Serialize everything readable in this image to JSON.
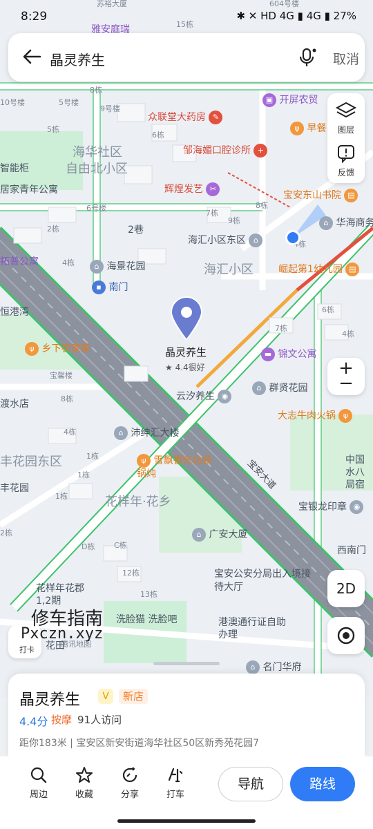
{
  "status_bar": {
    "time": "8:29",
    "right": "✱ ✕ HD 4G ▮ 4G ▮ 27%"
  },
  "search": {
    "query": "晶灵养生",
    "cancel_label": "取消"
  },
  "tools": {
    "layers_label": "图层",
    "feedback_label": "反馈"
  },
  "map": {
    "buildings": [
      "604号楼",
      "苏裕大厦",
      "雅安庭瑞",
      "15栋",
      "8栋",
      "10号楼",
      "5号楼",
      "9号楼",
      "5栋",
      "6栋",
      "6号楼",
      "2栋",
      "2巷",
      "4栋",
      "宝馨楼",
      "8栋",
      "4栋",
      "1栋",
      "1栋",
      "1栋",
      "2栋",
      "D栋",
      "C栋",
      "12栋",
      "13栋",
      "7栋",
      "9栋",
      "8栋",
      "6栋",
      "4栋",
      "7栋",
      "4栋"
    ],
    "districts": [
      "海华社区",
      "自由北小区",
      "海汇小区",
      "花样年·花乡",
      "丰花园东区"
    ],
    "labels": [
      {
        "text": "众联堂大药房",
        "cls": "poi-red"
      },
      {
        "text": "邹海媚口腔诊所",
        "cls": "poi-red"
      },
      {
        "text": "辉煌发艺",
        "cls": "poi-red"
      },
      {
        "text": "开屏农贸",
        "cls": "poi-purple"
      },
      {
        "text": "早餐",
        "cls": "poi-orange"
      },
      {
        "text": "宝安东山书院",
        "cls": "poi-orange"
      },
      {
        "text": "华海商务",
        "cls": ""
      },
      {
        "text": "海汇小区东区",
        "cls": ""
      },
      {
        "text": "崛起第1幼儿园",
        "cls": "poi-orange"
      },
      {
        "text": "海景花园",
        "cls": ""
      },
      {
        "text": "南门",
        "cls": "poi-blue"
      },
      {
        "text": "拓普公寓",
        "cls": "poi-purple"
      },
      {
        "text": "恒港湾",
        "cls": ""
      },
      {
        "text": "乡下农家菜",
        "cls": "poi-orange"
      },
      {
        "text": "锦文公寓",
        "cls": "poi-purple"
      },
      {
        "text": "群贤花园",
        "cls": ""
      },
      {
        "text": "云汐养生",
        "cls": ""
      },
      {
        "text": "大志牛肉火锅",
        "cls": "poi-orange"
      },
      {
        "text": "沛绅汇大楼",
        "cls": ""
      },
      {
        "text": "雪飘香东北铁锅炖",
        "cls": "poi-orange"
      },
      {
        "text": "广安大厦",
        "cls": ""
      },
      {
        "text": "宝银龙印章",
        "cls": ""
      },
      {
        "text": "西南门",
        "cls": ""
      },
      {
        "text": "宝安公安分局出入境接待大厅",
        "cls": ""
      },
      {
        "text": "花样年花郡1,2期",
        "cls": ""
      },
      {
        "text": "洗脸猫 洗脸吧",
        "cls": ""
      },
      {
        "text": "港澳通行证自助办理",
        "cls": ""
      },
      {
        "text": "名门华府",
        "cls": ""
      },
      {
        "text": "中国水八局宿",
        "cls": ""
      },
      {
        "text": "智能柜",
        "cls": ""
      },
      {
        "text": "居家青年公寓",
        "cls": ""
      },
      {
        "text": "渡水店",
        "cls": ""
      },
      {
        "text": "丰花园",
        "cls": ""
      },
      {
        "text": "花田",
        "cls": ""
      },
      {
        "text": "腾讯地图",
        "cls": "small"
      },
      {
        "text": "打卡",
        "cls": "small"
      }
    ],
    "road_name": "宝安大道",
    "marker": {
      "name": "晶灵养生",
      "rating": "★ 4.4很好"
    }
  },
  "watermark": {
    "line1": "修车指南",
    "line2": "Pxczn.xyz"
  },
  "controls": {
    "zoom_in": "+",
    "zoom_out": "−",
    "mode_2d": "2D"
  },
  "place_card": {
    "name": "晶灵养生",
    "badge": "V",
    "new_tag": "新店",
    "score": "4.4分",
    "category": "按摩",
    "visits": "91人访问",
    "address": "距你183米 | 宝安区新安街道海华社区50区新秀苑花园7"
  },
  "actions": {
    "nearby": "周边",
    "favorite": "收藏",
    "share": "分享",
    "taxi": "打车",
    "navigate": "导航",
    "route": "路线"
  },
  "colors": {
    "accent": "#2f7cf6",
    "road_green": "#3cc46a",
    "road_orange": "#f2a93b",
    "road_red": "#e3503e",
    "main_road": "#7b8290",
    "marker": "#6a7ccf"
  }
}
